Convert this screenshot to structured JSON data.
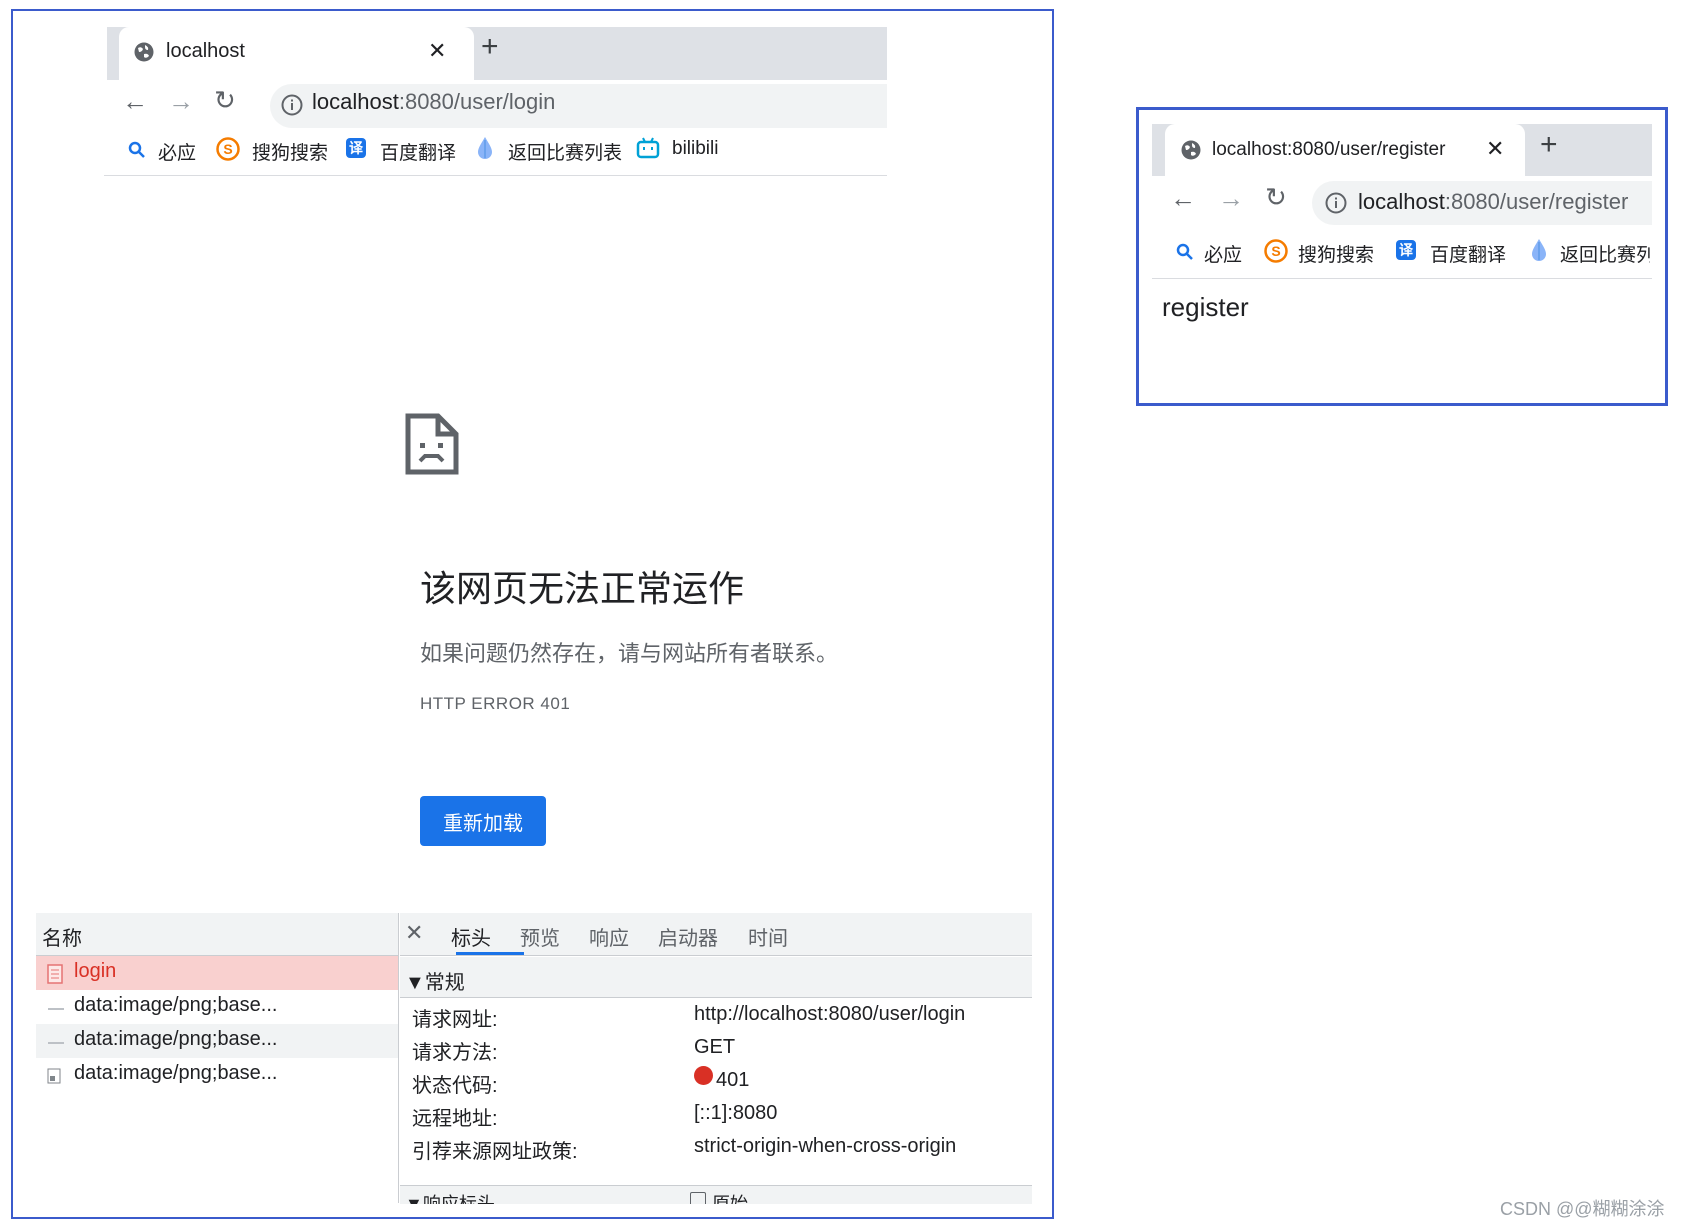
{
  "left_window": {
    "tab": {
      "title": "localhost",
      "close": "✕"
    },
    "new_tab": "+",
    "nav": {
      "back": "←",
      "forward": "→",
      "reload": "↻"
    },
    "address": {
      "host": "localhost",
      "rest": ":8080/user/login"
    },
    "bookmarks": [
      "必应",
      "搜狗搜索",
      "百度翻译",
      "返回比赛列表",
      "bilibili"
    ],
    "error_page": {
      "title": "该网页无法正常运作",
      "subtitle": "如果问题仍然存在，请与网站所有者联系。",
      "code": "HTTP ERROR 401",
      "reload_button": "重新加载"
    }
  },
  "devtools": {
    "name_column": "名称",
    "close": "✕",
    "tabs": [
      "标头",
      "预览",
      "响应",
      "启动器",
      "时间"
    ],
    "requests": [
      "login",
      "data:image/png;base...",
      "data:image/png;base...",
      "data:image/png;base..."
    ],
    "general_section": "▼常规",
    "headers": [
      {
        "key": "请求网址:",
        "value": "http://localhost:8080/user/login"
      },
      {
        "key": "请求方法:",
        "value": "GET"
      },
      {
        "key": "状态代码:",
        "value": "401"
      },
      {
        "key": "远程地址:",
        "value": "[::1]:8080"
      },
      {
        "key": "引荐来源网址政策:",
        "value": "strict-origin-when-cross-origin"
      }
    ],
    "response_section": "▼响应标头",
    "raw_checkbox": "原始"
  },
  "right_window": {
    "tab": {
      "title": "localhost:8080/user/register",
      "close": "✕"
    },
    "new_tab": "+",
    "nav": {
      "back": "←",
      "forward": "→",
      "reload": "↻"
    },
    "address": {
      "host": "localhost",
      "rest": ":8080/user/register"
    },
    "bookmarks": [
      "必应",
      "搜狗搜索",
      "百度翻译",
      "返回比赛列表"
    ],
    "page_text": "register"
  },
  "watermark": "CSDN @@糊糊涂涂",
  "colors": {
    "accent": "#1a73e8",
    "frame": "#3b5bcc",
    "error_red": "#d93025",
    "selected_row": "#f9d0cf"
  }
}
